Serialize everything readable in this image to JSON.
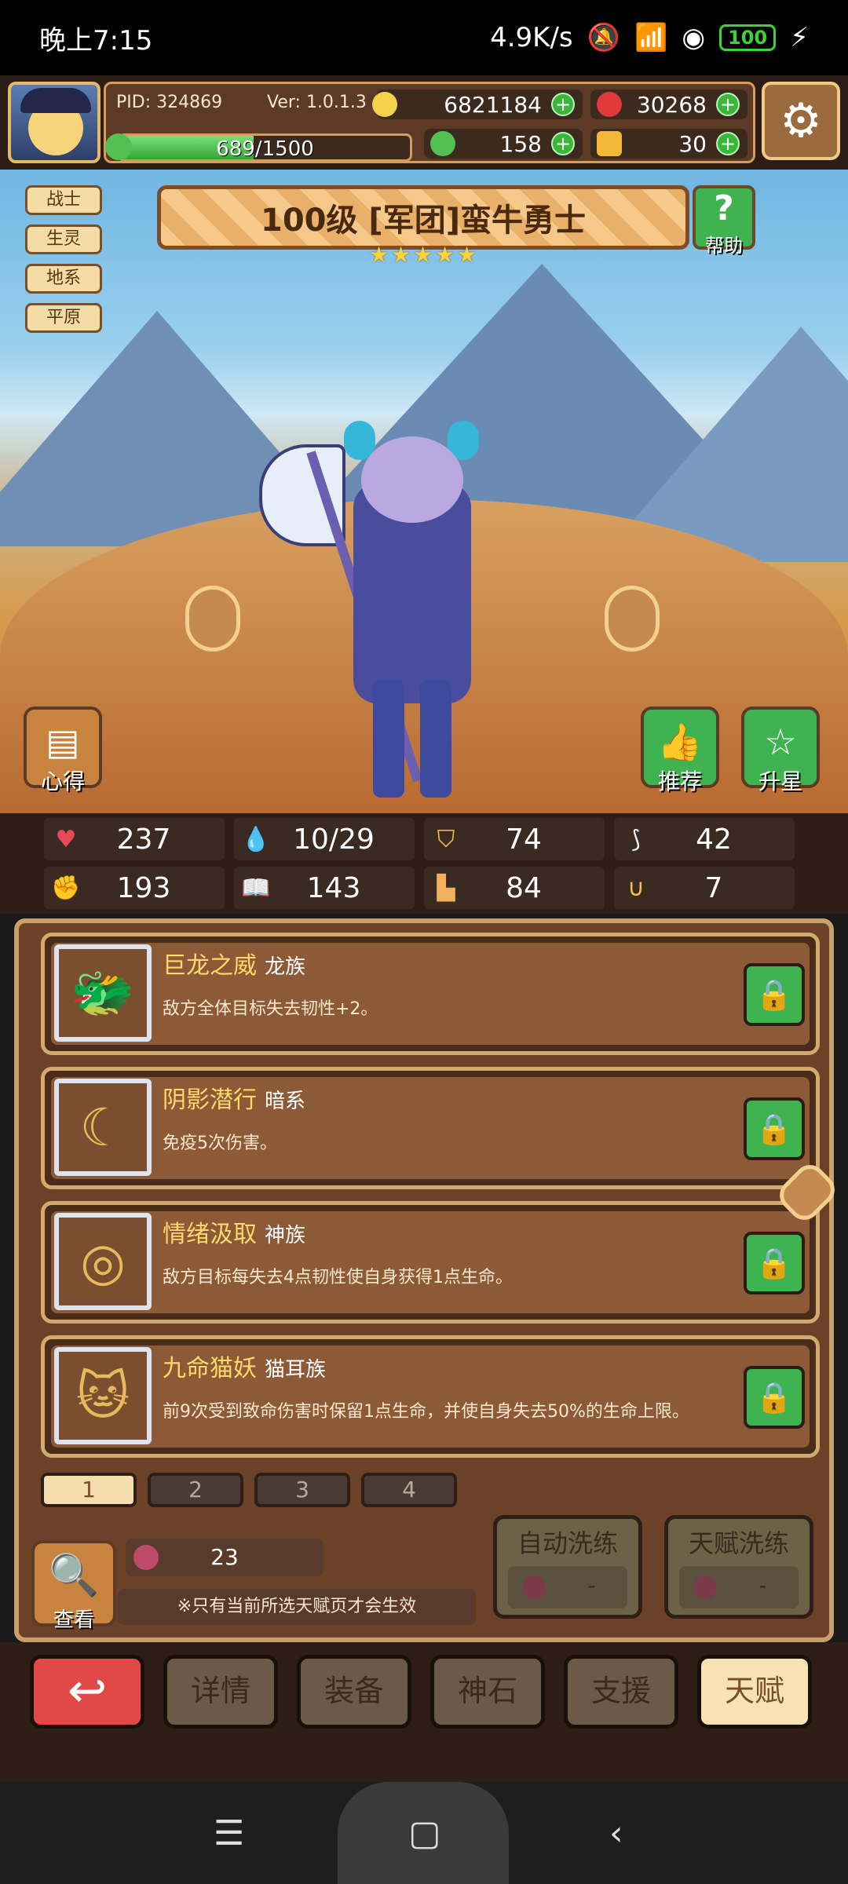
{
  "statusbar": {
    "time": "晚上7:15",
    "speed": "4.9K/s",
    "battery": "100"
  },
  "hud": {
    "pid": "PID: 324869",
    "version": "Ver: 1.0.1.3",
    "exp_text": "689/1500",
    "exp_progress": 0.46,
    "gold": "6821184",
    "ruby": "30268",
    "clover": "158",
    "key": "30"
  },
  "hero": {
    "tags": [
      "战士",
      "生灵",
      "地系",
      "平原"
    ],
    "title": "100级 [军团]蛮牛勇士",
    "stars": 5,
    "help_label": "帮助",
    "xinde_label": "心得",
    "recommend_label": "推荐",
    "upstar_label": "升星"
  },
  "stats": [
    {
      "icon": "heart-icon",
      "value": "237",
      "color": "#e64a5a"
    },
    {
      "icon": "mana-drop-icon",
      "value": "10/29",
      "color": "#5ac8f0"
    },
    {
      "icon": "shield-icon",
      "value": "74",
      "color": "#f2c24a"
    },
    {
      "icon": "wing-icon",
      "value": "42",
      "color": "#e8eef8"
    },
    {
      "icon": "fist-icon",
      "value": "193",
      "color": "#e87070"
    },
    {
      "icon": "book-icon",
      "value": "143",
      "color": "#6ab8f0"
    },
    {
      "icon": "boot-icon",
      "value": "84",
      "color": "#f0b060"
    },
    {
      "icon": "magnet-icon",
      "value": "7",
      "color": "#f2c24a"
    }
  ],
  "talents": [
    {
      "name": "巨龙之威",
      "race": "龙族",
      "desc": "敌方全体目标失去韧性+2。",
      "icon": "dragon-icon"
    },
    {
      "name": "阴影潜行",
      "race": "暗系",
      "desc": "免疫5次伤害。",
      "icon": "moon-icon"
    },
    {
      "name": "情绪汲取",
      "race": "神族",
      "desc": "敌方目标每失去4点韧性使自身获得1点生命。",
      "icon": "eye-icon"
    },
    {
      "name": "九命猫妖",
      "race": "猫耳族",
      "desc": "前9次受到致命伤害时保留1点生命，并使自身失去50%的生命上限。",
      "icon": "cat-icon"
    }
  ],
  "pages": [
    "1",
    "2",
    "3",
    "4"
  ],
  "active_page": 0,
  "bottom": {
    "view_label": "查看",
    "fruit_count": "23",
    "note": "※只有当前所选天赋页才会生效",
    "auto_wash": "自动洗练",
    "talent_wash": "天赋洗练",
    "auto_wash_cost": "-",
    "talent_wash_cost": "-"
  },
  "nav": {
    "back_icon": "return-icon",
    "items": [
      "详情",
      "装备",
      "神石",
      "支援",
      "天赋"
    ],
    "active": 4
  }
}
